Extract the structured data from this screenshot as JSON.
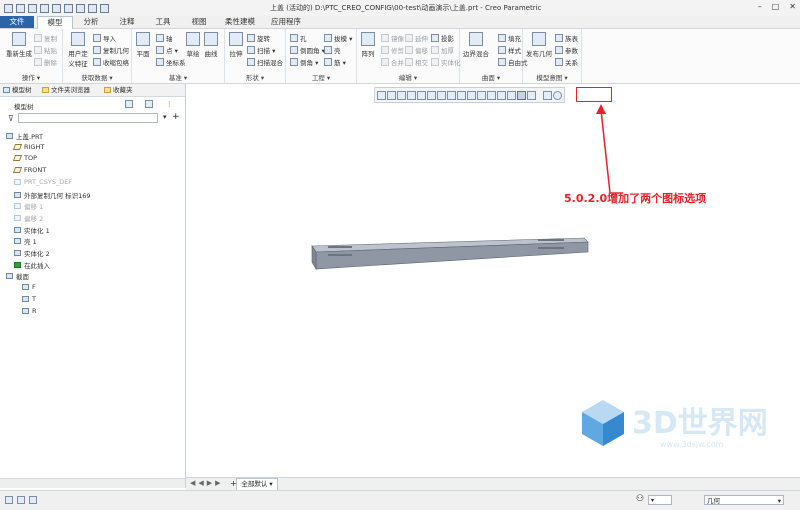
{
  "window": {
    "title": "上盖 (活动的) D:\\PTC_CREO_CONFIG\\00-test\\动画演示\\上盖.prt - Creo Parametric",
    "controls": [
      "–",
      "□",
      "✕"
    ]
  },
  "tabs": [
    "文件",
    "模型",
    "分析",
    "注释",
    "工具",
    "视图",
    "柔性建模",
    "应用程序"
  ],
  "active_tab": "模型",
  "ribbon": {
    "groups": [
      {
        "label": "操作 ▾",
        "buttons": [
          "重新生成",
          "复制",
          "粘贴",
          "删除"
        ]
      },
      {
        "label": "获取数据 ▾",
        "buttons": [
          "用户定义特征",
          "导入",
          "复制几何",
          "收缩包络"
        ]
      },
      {
        "label": "基准 ▾",
        "buttons": [
          "平面",
          "轴",
          "点 ▾",
          "坐标系",
          "草绘",
          "曲线"
        ]
      },
      {
        "label": "形状 ▾",
        "buttons": [
          "拉伸",
          "旋转",
          "扫描 ▾",
          "扫描混合"
        ]
      },
      {
        "label": "工程 ▾",
        "buttons": [
          "孔",
          "倒圆角 ▾",
          "倒角 ▾",
          "拔模 ▾",
          "壳",
          "筋 ▾"
        ]
      },
      {
        "label": "编辑 ▾",
        "buttons": [
          "阵列",
          "镜像",
          "延伸",
          "投影",
          "修剪",
          "偏移",
          "加厚",
          "合并",
          "相交",
          "实体化"
        ]
      },
      {
        "label": "曲面 ▾",
        "buttons": [
          "边界混合",
          "填充",
          "样式",
          "自由式"
        ]
      },
      {
        "label": "模型意图 ▾",
        "buttons": [
          "发布几何",
          "族表",
          "参数",
          "关系"
        ]
      }
    ]
  },
  "left_panel": {
    "tabs": [
      "模型树",
      "文件夹浏览器",
      "收藏夹"
    ],
    "header": "模型树",
    "search_placeholder": "",
    "tree": [
      {
        "label": "上盖.PRT",
        "type": "part",
        "dim": false,
        "indent": 0
      },
      {
        "label": "RIGHT",
        "type": "plane",
        "dim": false,
        "indent": 1
      },
      {
        "label": "TOP",
        "type": "plane",
        "dim": false,
        "indent": 1
      },
      {
        "label": "FRONT",
        "type": "plane",
        "dim": false,
        "indent": 1
      },
      {
        "label": "PRT_CSYS_DEF",
        "type": "csys",
        "dim": true,
        "indent": 1
      },
      {
        "label": "外部复制几何 标识169",
        "type": "geom",
        "dim": false,
        "indent": 1
      },
      {
        "label": "偏移 1",
        "type": "offset",
        "dim": true,
        "indent": 1
      },
      {
        "label": "偏移 2",
        "type": "offset",
        "dim": true,
        "indent": 1
      },
      {
        "label": "实体化 1",
        "type": "solid",
        "dim": false,
        "indent": 1
      },
      {
        "label": "壳 1",
        "type": "shell",
        "dim": false,
        "indent": 1
      },
      {
        "label": "实体化 2",
        "type": "solid",
        "dim": false,
        "indent": 1
      },
      {
        "label": "在此插入",
        "type": "insert",
        "dim": false,
        "indent": 1
      },
      {
        "label": "截面",
        "type": "folder",
        "dim": false,
        "indent": 0
      },
      {
        "label": "F",
        "type": "section",
        "dim": false,
        "indent": 2
      },
      {
        "label": "T",
        "type": "section",
        "dim": false,
        "indent": 2
      },
      {
        "label": "R",
        "type": "section",
        "dim": false,
        "indent": 2
      }
    ]
  },
  "annotation": "5.0.2.0增加了两个图标选项",
  "sheet_tab": "全部默认 ▾",
  "status": {
    "filter": "几何"
  },
  "watermark": {
    "text": "3D世界网",
    "url": "www.3dsjw.com"
  },
  "colors": {
    "file_tab": "#2b65a8",
    "annotation": "#e8202a",
    "model": "#8f96a4"
  }
}
